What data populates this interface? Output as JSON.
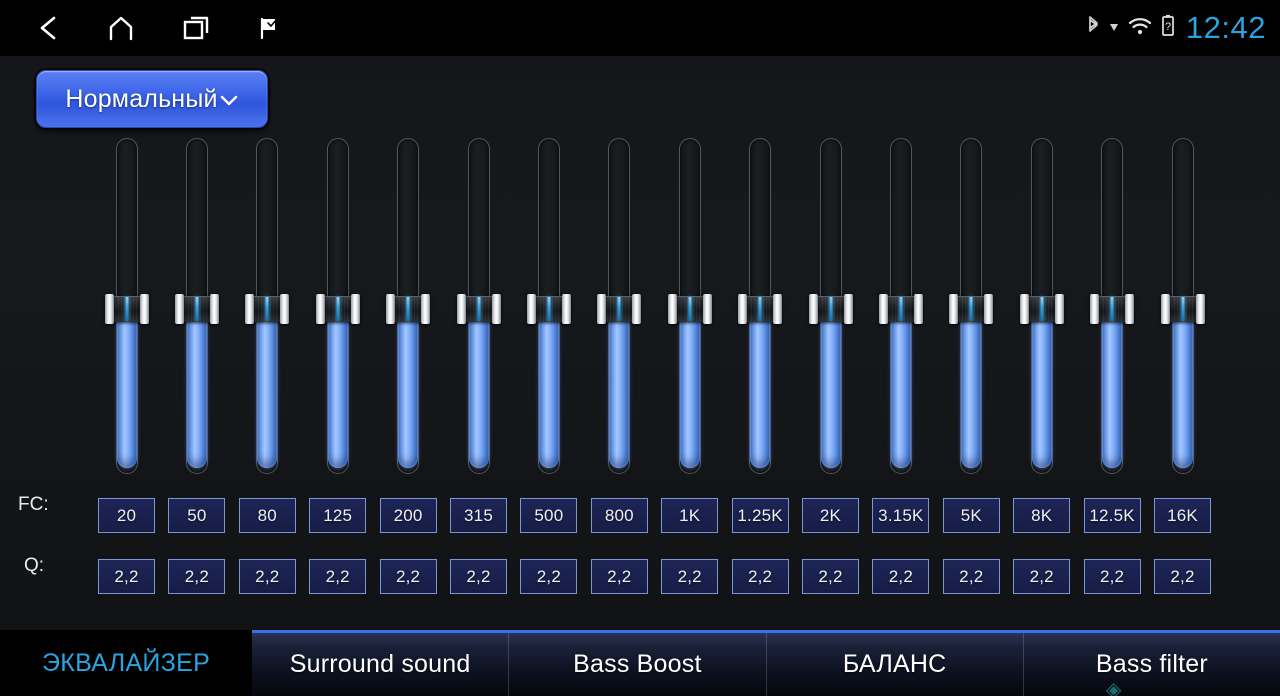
{
  "statusbar": {
    "nav": [
      {
        "name": "back-icon",
        "label": "Back"
      },
      {
        "name": "home-icon",
        "label": "Home"
      },
      {
        "name": "recents-icon",
        "label": "Recent apps"
      },
      {
        "name": "flag-icon",
        "label": "Flag"
      }
    ],
    "indicators": [
      {
        "name": "bluetooth-icon",
        "label": "Bluetooth"
      },
      {
        "name": "signal-icon",
        "label": "Signal"
      },
      {
        "name": "wifi-icon",
        "label": "Wi-Fi"
      },
      {
        "name": "battery-unknown-icon",
        "label": "Battery unknown"
      }
    ],
    "clock": "12:42"
  },
  "preset": {
    "label": "Нормальный",
    "caret": "⌄"
  },
  "equalizer": {
    "fc_label": "FC:",
    "q_label": "Q:",
    "bands": [
      {
        "fc": "20",
        "q": "2,2",
        "level": 50
      },
      {
        "fc": "50",
        "q": "2,2",
        "level": 50
      },
      {
        "fc": "80",
        "q": "2,2",
        "level": 50
      },
      {
        "fc": "125",
        "q": "2,2",
        "level": 50
      },
      {
        "fc": "200",
        "q": "2,2",
        "level": 50
      },
      {
        "fc": "315",
        "q": "2,2",
        "level": 50
      },
      {
        "fc": "500",
        "q": "2,2",
        "level": 50
      },
      {
        "fc": "800",
        "q": "2,2",
        "level": 50
      },
      {
        "fc": "1K",
        "q": "2,2",
        "level": 50
      },
      {
        "fc": "1.25K",
        "q": "2,2",
        "level": 50
      },
      {
        "fc": "2K",
        "q": "2,2",
        "level": 50
      },
      {
        "fc": "3.15K",
        "q": "2,2",
        "level": 50
      },
      {
        "fc": "5K",
        "q": "2,2",
        "level": 50
      },
      {
        "fc": "8K",
        "q": "2,2",
        "level": 50
      },
      {
        "fc": "12.5K",
        "q": "2,2",
        "level": 50
      },
      {
        "fc": "16K",
        "q": "2,2",
        "level": 50
      }
    ]
  },
  "tabs": {
    "active": "ЭКВАЛАЙЗЕР",
    "items": [
      {
        "label": "Surround sound"
      },
      {
        "label": "Bass Boost"
      },
      {
        "label": "БАЛАНС"
      },
      {
        "label": "Bass filter"
      }
    ]
  },
  "watermark": "◈",
  "colors": {
    "accent_blue": "#2aa4e0",
    "slider_blue": "#6fa4f5",
    "tab_border": "#3b6ff0",
    "box_border": "#8094d8",
    "box_fill": "#1d2557"
  }
}
